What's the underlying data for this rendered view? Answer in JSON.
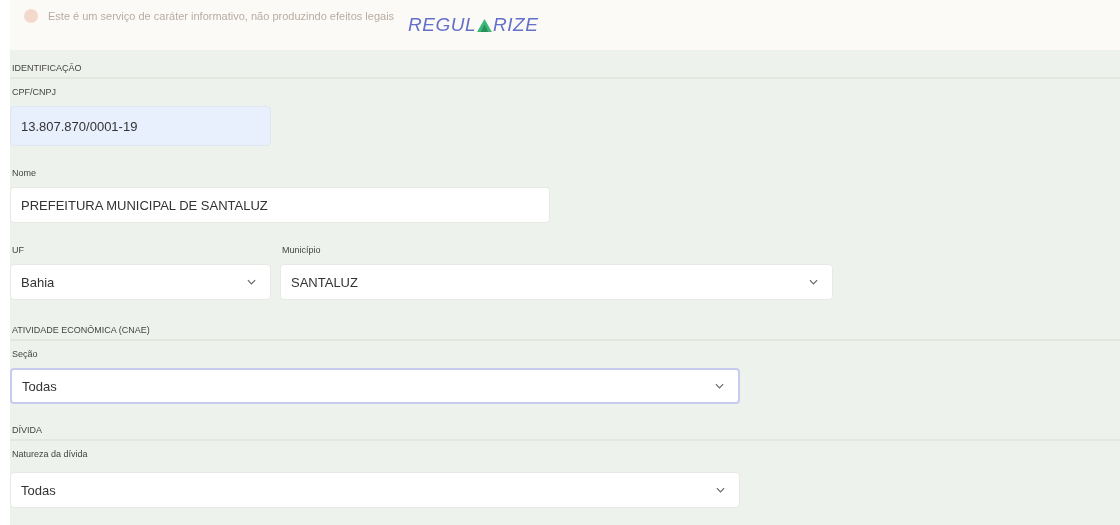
{
  "notice": {
    "text": "Este é um serviço de caráter informativo, não produzindo efeitos legais"
  },
  "logo": {
    "text_before": "REGUL",
    "text_after": "RIZE"
  },
  "sections": [
    {
      "title": "IDENTIFICAÇÃO",
      "rows": [
        [
          {
            "label": "CPF/CNPJ",
            "kind": "text",
            "value": "13.807.870/0001-19",
            "autofilled": true
          }
        ],
        [
          {
            "label": "Nome",
            "kind": "text",
            "value": "PREFEITURA MUNICIPAL DE SANTALUZ",
            "autofilled": false
          }
        ],
        [
          {
            "label": "UF",
            "kind": "select",
            "value": "Bahia",
            "focused": false
          },
          {
            "label": "Município",
            "kind": "select",
            "value": "SANTALUZ",
            "focused": false
          }
        ]
      ]
    },
    {
      "title": "ATIVIDADE ECONÔMICA (CNAE)",
      "rows": [
        [
          {
            "label": "Seção",
            "kind": "select",
            "value": "Todas",
            "focused": true
          }
        ]
      ]
    },
    {
      "title": "DÍVIDA",
      "rows": [
        [
          {
            "label": "Natureza da dívida",
            "kind": "select",
            "value": "Todas",
            "focused": false
          }
        ]
      ]
    }
  ]
}
